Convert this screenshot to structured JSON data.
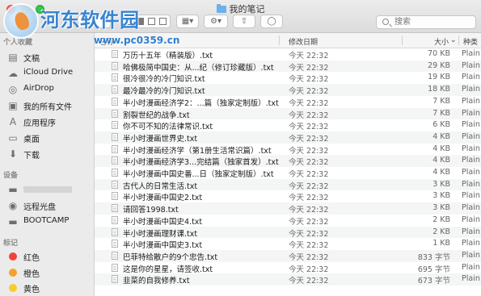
{
  "window": {
    "title": "我的笔记"
  },
  "toolbar": {
    "search_placeholder": "搜索",
    "icons": [
      "back-icon",
      "forward-icon",
      "view-mode-icon",
      "grid-icon",
      "gear-icon",
      "share-icon",
      "tag-icon"
    ]
  },
  "watermark": {
    "name": "河东软件园",
    "url": "www.pc0359.cn"
  },
  "sidebar": {
    "favorites_header": "个人收藏",
    "favorites": [
      {
        "label": "文稿",
        "icon": "document-icon"
      },
      {
        "label": "iCloud Drive",
        "icon": "cloud-icon"
      },
      {
        "label": "AirDrop",
        "icon": "airdrop-icon"
      },
      {
        "label": "我的所有文件",
        "icon": "all-files-icon"
      },
      {
        "label": "应用程序",
        "icon": "applications-icon"
      },
      {
        "label": "桌面",
        "icon": "desktop-icon"
      },
      {
        "label": "下载",
        "icon": "download-icon"
      }
    ],
    "devices_header": "设备",
    "devices": [
      {
        "label": "",
        "icon": "disk-icon"
      },
      {
        "label": "远程光盘",
        "icon": "remote-disc-icon"
      },
      {
        "label": "BOOTCAMP",
        "icon": "disk-icon"
      }
    ],
    "tags_header": "标记",
    "tags": [
      {
        "label": "红色",
        "color": "#f0443a"
      },
      {
        "label": "橙色",
        "color": "#f6a030"
      },
      {
        "label": "黄色",
        "color": "#f7cd2d"
      }
    ]
  },
  "columns": {
    "name": "名称",
    "date": "修改日期",
    "size": "大小",
    "kind": "种类"
  },
  "files": [
    {
      "name": "万历十五年（精装版）.txt",
      "date": "今天 22:32",
      "size": "70 KB",
      "kind": "Plain"
    },
    {
      "name": "哈佛极简中国史：从...纪（修订珍藏版）.txt",
      "date": "今天 22:32",
      "size": "29 KB",
      "kind": "Plain"
    },
    {
      "name": "很冷很冷的冷门知识.txt",
      "date": "今天 22:32",
      "size": "19 KB",
      "kind": "Plain"
    },
    {
      "name": "最冷最冷的冷门知识.txt",
      "date": "今天 22:32",
      "size": "18 KB",
      "kind": "Plain"
    },
    {
      "name": "半小时漫画经济学2：...篇（独家定制版）.txt",
      "date": "今天 22:32",
      "size": "7 KB",
      "kind": "Plain"
    },
    {
      "name": "割裂世纪的战争.txt",
      "date": "今天 22:32",
      "size": "7 KB",
      "kind": "Plain"
    },
    {
      "name": "你不可不知的法律常识.txt",
      "date": "今天 22:32",
      "size": "6 KB",
      "kind": "Plain"
    },
    {
      "name": "半小时漫画世界史.txt",
      "date": "今天 22:32",
      "size": "4 KB",
      "kind": "Plain"
    },
    {
      "name": "半小时漫画经济学（第1册生活常识篇）.txt",
      "date": "今天 22:32",
      "size": "4 KB",
      "kind": "Plain"
    },
    {
      "name": "半小时漫画经济学3...完结篇（独家首发）.txt",
      "date": "今天 22:32",
      "size": "4 KB",
      "kind": "Plain"
    },
    {
      "name": "半小时漫画中国史番...日（独家定制版）.txt",
      "date": "今天 22:32",
      "size": "4 KB",
      "kind": "Plain"
    },
    {
      "name": "古代人的日常生活.txt",
      "date": "今天 22:32",
      "size": "3 KB",
      "kind": "Plain"
    },
    {
      "name": "半小时漫画中国史2.txt",
      "date": "今天 22:32",
      "size": "3 KB",
      "kind": "Plain"
    },
    {
      "name": "请回答1998.txt",
      "date": "今天 22:32",
      "size": "3 KB",
      "kind": "Plain"
    },
    {
      "name": "半小时漫画中国史4.txt",
      "date": "今天 22:32",
      "size": "2 KB",
      "kind": "Plain"
    },
    {
      "name": "半小时漫画理财课.txt",
      "date": "今天 22:32",
      "size": "2 KB",
      "kind": "Plain"
    },
    {
      "name": "半小时漫画中国史3.txt",
      "date": "今天 22:32",
      "size": "1 KB",
      "kind": "Plain"
    },
    {
      "name": "巴菲特给散户的9个忠告.txt",
      "date": "今天 22:32",
      "size": "833 字节",
      "kind": "Plain"
    },
    {
      "name": "这是你的星星，请签收.txt",
      "date": "今天 22:32",
      "size": "695 字节",
      "kind": "Plain"
    },
    {
      "name": "韭菜的自我修养.txt",
      "date": "今天 22:32",
      "size": "673 字节",
      "kind": "Plain"
    }
  ]
}
